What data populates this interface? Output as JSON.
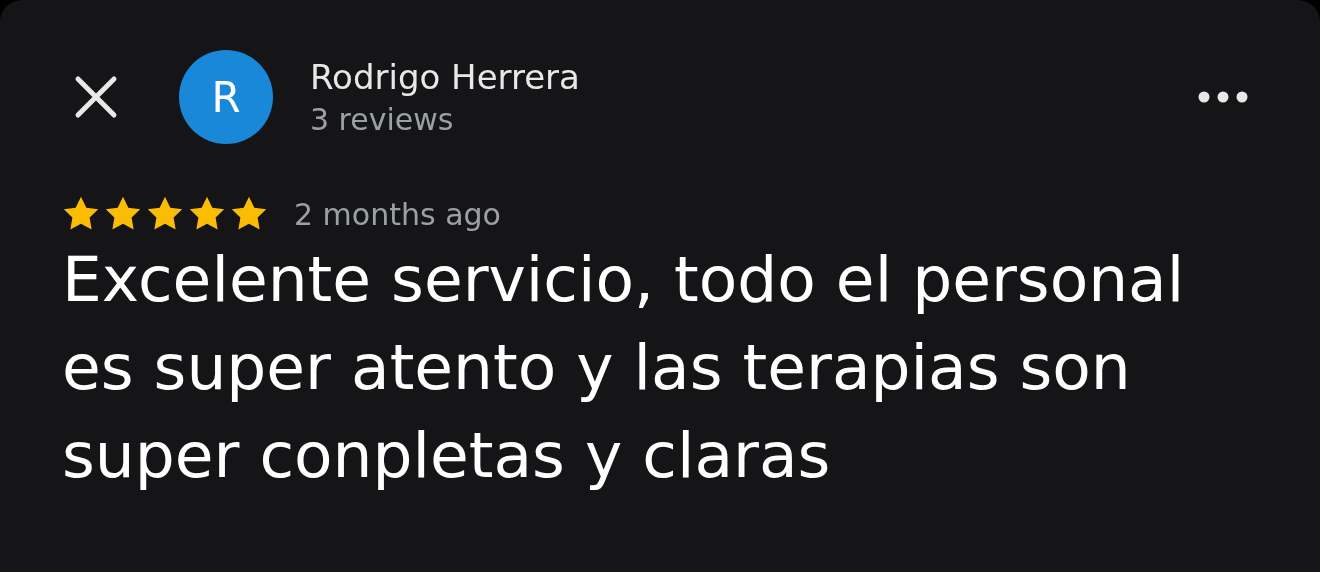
{
  "reviewer": {
    "initial": "R",
    "name": "Rodrigo Herrera",
    "reviews": "3 reviews"
  },
  "review": {
    "stars": 5,
    "time": "2 months ago",
    "text": "Excelente servicio, todo el personal es super atento y las terapias son super conpletas y claras"
  }
}
